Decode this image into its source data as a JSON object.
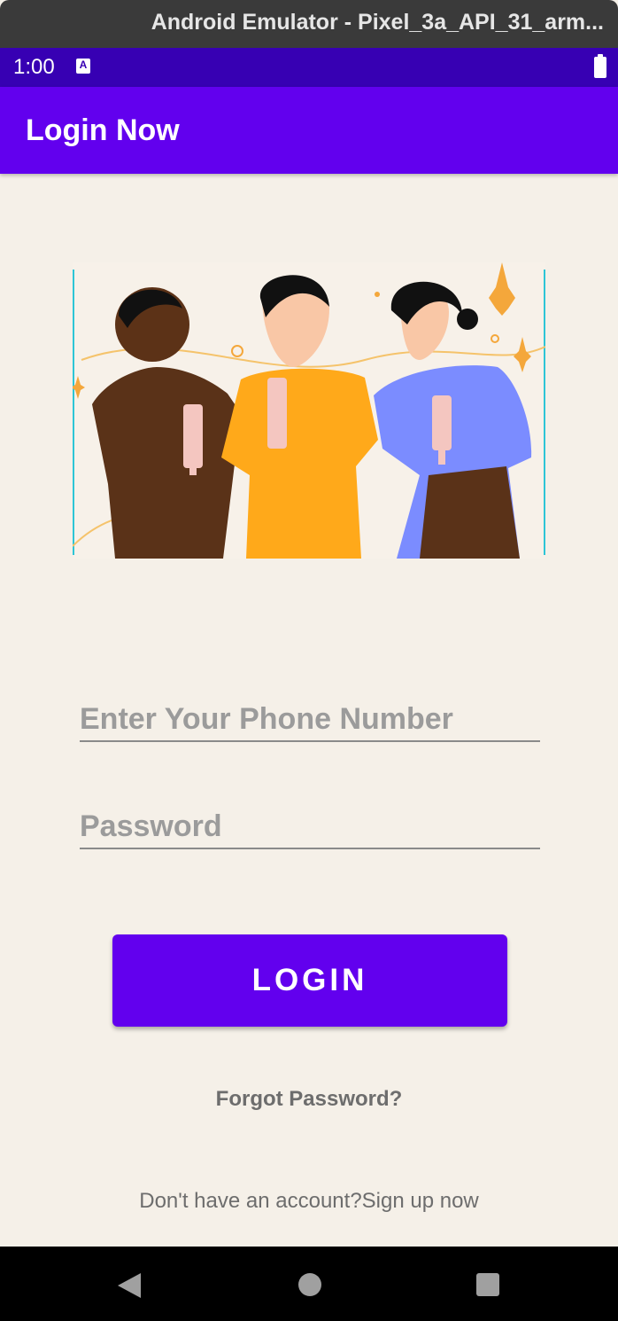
{
  "window": {
    "title": "Android Emulator - Pixel_3a_API_31_arm..."
  },
  "status_bar": {
    "time": "1:00",
    "notification_icon": "A"
  },
  "app_bar": {
    "title": "Login Now"
  },
  "form": {
    "phone_placeholder": "Enter Your Phone Number",
    "phone_value": "",
    "password_placeholder": "Password",
    "password_value": "",
    "login_label": "LOGIN",
    "forgot_password": "Forgot Password?",
    "signup_text": "Don't have an account?Sign up now"
  },
  "colors": {
    "primary": "#6200ee",
    "status_bar": "#3700b3",
    "background": "#f5f0e8"
  },
  "icons": [
    "battery-icon",
    "back-icon",
    "home-icon",
    "recents-icon"
  ]
}
